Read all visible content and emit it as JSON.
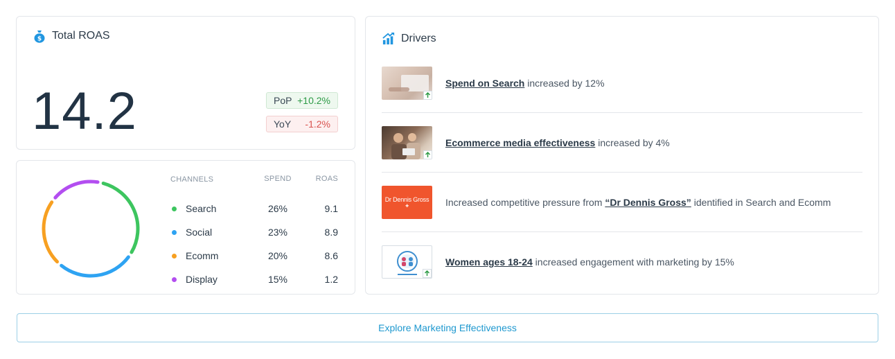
{
  "roas": {
    "title": "Total ROAS",
    "icon": "money-bag-icon",
    "value": "14.2",
    "pop": {
      "label": "PoP",
      "value": "+10.2%",
      "color": "#2e9b47"
    },
    "yoy": {
      "label": "YoY",
      "value": "-1.2%",
      "color": "#d9534f"
    }
  },
  "channels": {
    "headers": {
      "name": "CHANNELS",
      "spend": "SPEND",
      "roas": "ROAS"
    },
    "rows": [
      {
        "name": "Search",
        "spend": "26%",
        "roas": "9.1",
        "color": "#3dc55f"
      },
      {
        "name": "Social",
        "spend": "23%",
        "roas": "8.9",
        "color": "#2ea3f2"
      },
      {
        "name": "Ecomm",
        "spend": "20%",
        "roas": "8.6",
        "color": "#f7a021"
      },
      {
        "name": "Display",
        "spend": "15%",
        "roas": "1.2",
        "color": "#b34ef0"
      }
    ]
  },
  "drivers": {
    "title": "Drivers",
    "icon": "chart-arrow-icon",
    "items": [
      {
        "pre": "",
        "link": "Spend on Search",
        "post": " increased by 12%",
        "thumb": "laptop-thumbnail",
        "trend": "up-arrow-icon"
      },
      {
        "pre": "",
        "link": "Ecommerce media effectiveness",
        "post": " increased by 4%",
        "thumb": "shopping-couple-thumbnail",
        "trend": "up-arrow-icon"
      },
      {
        "pre": "Increased competitive pressure from ",
        "link": "“Dr Dennis Gross”",
        "post": " identified in Search and Ecomm",
        "thumb": "dr-dennis-gross-logo",
        "logo_text": "Dr Dennis Gross"
      },
      {
        "pre": "",
        "link": "Women ages 18-24",
        "post": " increased engagement with marketing by 15%",
        "thumb": "audience-logo-thumbnail",
        "trend": "up-arrow-icon"
      }
    ]
  },
  "explore_button": {
    "label": "Explore Marketing Effectiveness"
  }
}
